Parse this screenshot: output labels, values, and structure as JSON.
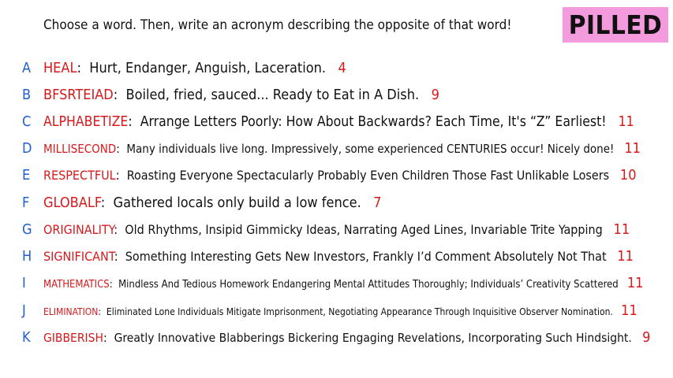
{
  "prompt": "Choose a word. Then, write an acronym describing the opposite of that word!",
  "logo": "PILLED",
  "colors": {
    "letter": "#1f5fd1",
    "word": "#d7191c",
    "count": "#d7191c",
    "logo_bg": "#f39bdd"
  },
  "items": [
    {
      "letter": "A",
      "word": "HEAL",
      "definition": "Hurt, Endanger, Anguish, Laceration.",
      "count": "4"
    },
    {
      "letter": "B",
      "word": "BFSRTEIAD",
      "definition": "Boiled, fried, sauced... Ready to Eat in A Dish.",
      "count": "9"
    },
    {
      "letter": "C",
      "word": "ALPHABETIZE",
      "definition": "Arrange Letters Poorly: How About Backwards? Each Time, It's “Z” Earliest!",
      "count": "11"
    },
    {
      "letter": "D",
      "word": "MILLISECOND",
      "definition": "Many individuals live long. Impressively, some experienced CENTURIES occur! Nicely done!",
      "count": "11"
    },
    {
      "letter": "E",
      "word": "RESPECTFUL",
      "definition": "Roasting Everyone Spectacularly Probably  Even Children  Those Fast Unlikable Losers",
      "count": "10"
    },
    {
      "letter": "F",
      "word": "GLOBALF",
      "definition": "Gathered locals only build a low fence.",
      "count": "7"
    },
    {
      "letter": "G",
      "word": "ORIGINALITY",
      "definition": "Old Rhythms, Insipid Gimmicky Ideas, Narrating Aged Lines, Invariable Trite Yapping",
      "count": "11"
    },
    {
      "letter": "H",
      "word": "SIGNIFICANT",
      "definition": "Something Interesting Gets New Investors, Frankly I’d Comment Absolutely Not That",
      "count": "11"
    },
    {
      "letter": "I",
      "word": "MATHEMATICS",
      "definition": "Mindless And Tedious Homework Endangering Mental Attitudes Thoroughly; Individuals’ Creativity Scattered",
      "count": "11"
    },
    {
      "letter": "J",
      "word": "ELIMINATION",
      "definition": "Eliminated Lone Individuals Mitigate Imprisonment, Negotiating Appearance Through Inquisitive Observer Nomination.",
      "count": "11"
    },
    {
      "letter": "K",
      "word": "GIBBERISH",
      "definition": "Greatly Innovative Blabberings Bickering Engaging Revelations, Incorporating Such Hindsight.",
      "count": "9"
    }
  ]
}
